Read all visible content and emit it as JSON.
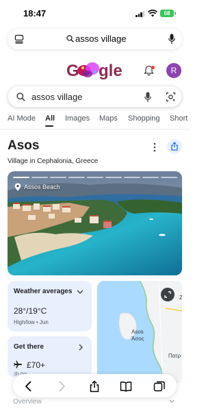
{
  "status": {
    "time": "18:47",
    "battery": "68"
  },
  "address_bar": {
    "query": "assos village"
  },
  "google": {
    "avatar_letter": "R"
  },
  "search": {
    "query": "assos village"
  },
  "tabs": [
    "AI Mode",
    "All",
    "Images",
    "Maps",
    "Shopping",
    "Short"
  ],
  "active_tab": "All",
  "knowledge_panel": {
    "title": "Asos",
    "subtitle": "Village in Cephalonia, Greece",
    "image_label": "Assos Beach"
  },
  "cards": {
    "weather": {
      "title": "Weather averages",
      "temp": "28°/19°C",
      "caption": "High/low • Jun"
    },
    "travel": {
      "title": "Get there",
      "price": "£70+",
      "caption": "3h 0m"
    }
  },
  "map": {
    "labels": [
      "Asos",
      "Άσος",
      "Πατρ",
      "Ζ"
    ]
  },
  "overview": {
    "label": "Overview"
  },
  "colors": {
    "accent_blue": "#1a73e8",
    "card_bg": "#e8f0fe",
    "avatar": "#8e44ad",
    "battery": "#34c759"
  }
}
